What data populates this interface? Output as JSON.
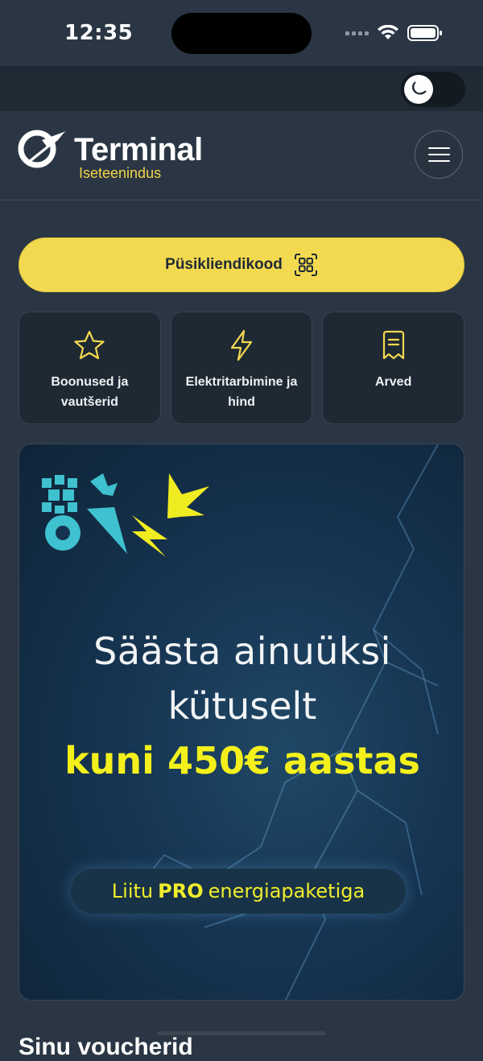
{
  "status_bar": {
    "time": "12:35"
  },
  "theme_toggle": {
    "mode": "dark",
    "icon": "moon-icon"
  },
  "header": {
    "logo_word": "Terminal",
    "logo_sub": "Iseteenindus",
    "menu_icon": "hamburger-icon"
  },
  "loyalty_button": {
    "label": "Püsikliendikood",
    "icon": "qr-code-icon"
  },
  "tiles": [
    {
      "label": "Boonused ja vautšerid",
      "icon": "star-icon"
    },
    {
      "label": "Elektritarbimine ja hind",
      "icon": "lightning-icon"
    },
    {
      "label": "Arved",
      "icon": "receipt-icon"
    }
  ],
  "banner": {
    "line1": "Säästa ainuüksi",
    "line2": "kütuselt",
    "line3": "kuni 450€ aastas",
    "cta_prefix": "Liitu",
    "cta_bold": "PRO",
    "cta_suffix": "energiapaketiga"
  },
  "next_section": {
    "heading": "Sinu voucherid"
  },
  "colors": {
    "background": "#2a3643",
    "accent_yellow": "#f3d94f",
    "tile_bg": "#1f2933",
    "banner_highlight": "#f3f01c"
  }
}
